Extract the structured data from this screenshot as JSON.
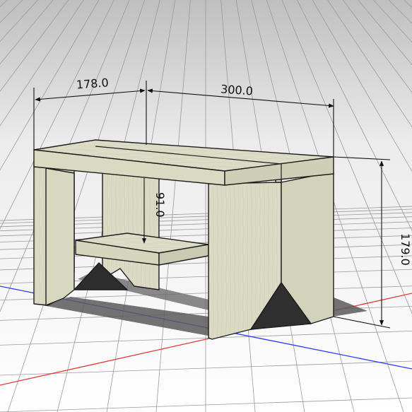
{
  "viewport": {
    "background": "#ffffff",
    "ground_grid": "on"
  },
  "axes": {
    "red_axis_color": "#e23a3a",
    "blue_axis_color": "#2b3cff"
  },
  "model": {
    "name": "step-stool",
    "wood_color": "#dcdcc6",
    "edge_color": "#1d1d1d"
  },
  "dimensions": {
    "depth": "178.0",
    "width": "300.0",
    "height": "179.0",
    "step_height": "91.0"
  }
}
